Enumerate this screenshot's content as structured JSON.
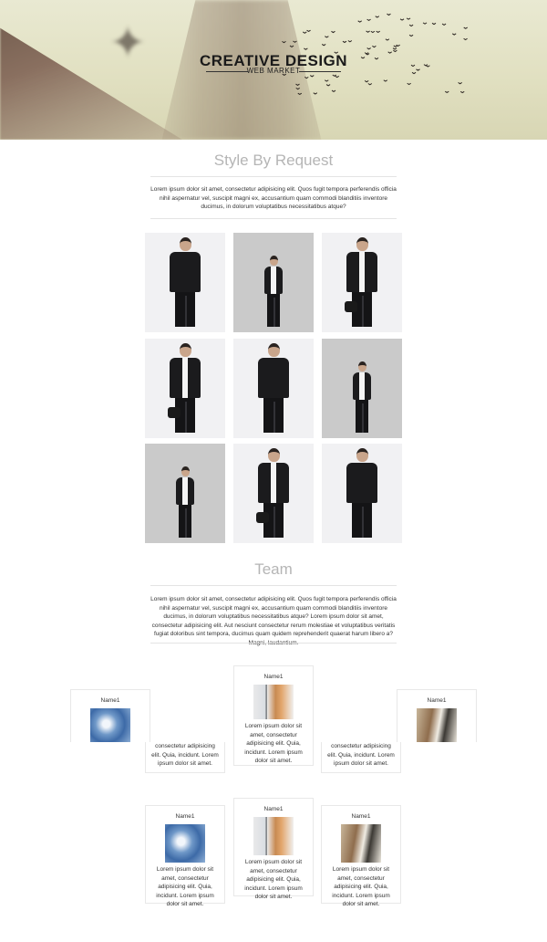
{
  "hero": {
    "title": "CREATIVE DESIGN",
    "subtitle": "WEB MARKET"
  },
  "style_section": {
    "title": "Style By Request",
    "paragraph": "Lorem ipsum dolor sit amet, consectetur adipisicing elit. Quos fugit tempora perferendis officia nihil aspernatur vel, suscipit magni ex, accusantium quam commodi blanditiis inventore ducimus, in dolorum voluptatibus necessitatibus atque?"
  },
  "gallery": {
    "tiles": [
      {
        "bg": "light",
        "pose": "sweater"
      },
      {
        "bg": "grey",
        "pose": "blazer"
      },
      {
        "bg": "light",
        "pose": "bomber-bag"
      },
      {
        "bg": "light",
        "pose": "bomber-bag"
      },
      {
        "bg": "light",
        "pose": "sweater"
      },
      {
        "bg": "grey",
        "pose": "blazer"
      },
      {
        "bg": "grey",
        "pose": "blazer"
      },
      {
        "bg": "light",
        "pose": "bomber-bag"
      },
      {
        "bg": "light",
        "pose": "sweater"
      }
    ]
  },
  "team_section": {
    "title": "Team",
    "paragraph": "Lorem ipsum dolor sit amet, consectetur adipisicing elit. Quos fugit tempora perferendis officia nihil aspernatur vel, suscipit magni ex, accusantium quam commodi blanditiis inventore ducimus, in dolorum voluptatibus necessitatibus atque? Lorem ipsum dolor sit amet, consectetur adipisicing elit. Aut nesciunt consectetur rerum molestiae et voluptatibus veritatis fugiat doloribus sint tempora, ducimus quam quidem reprehenderit quaerat harum libero a? Magni, laudantium."
  },
  "team": {
    "name": "Name1",
    "text_full": "Lorem ipsum dolor sit amet, consectetur adipisicing elit. Quia, incidunt. Lorem ipsum dolor sit amet.",
    "text_partial": "consectetur adipisicing elit. Quia, incidunt. Lorem ipsum dolor sit amet."
  }
}
